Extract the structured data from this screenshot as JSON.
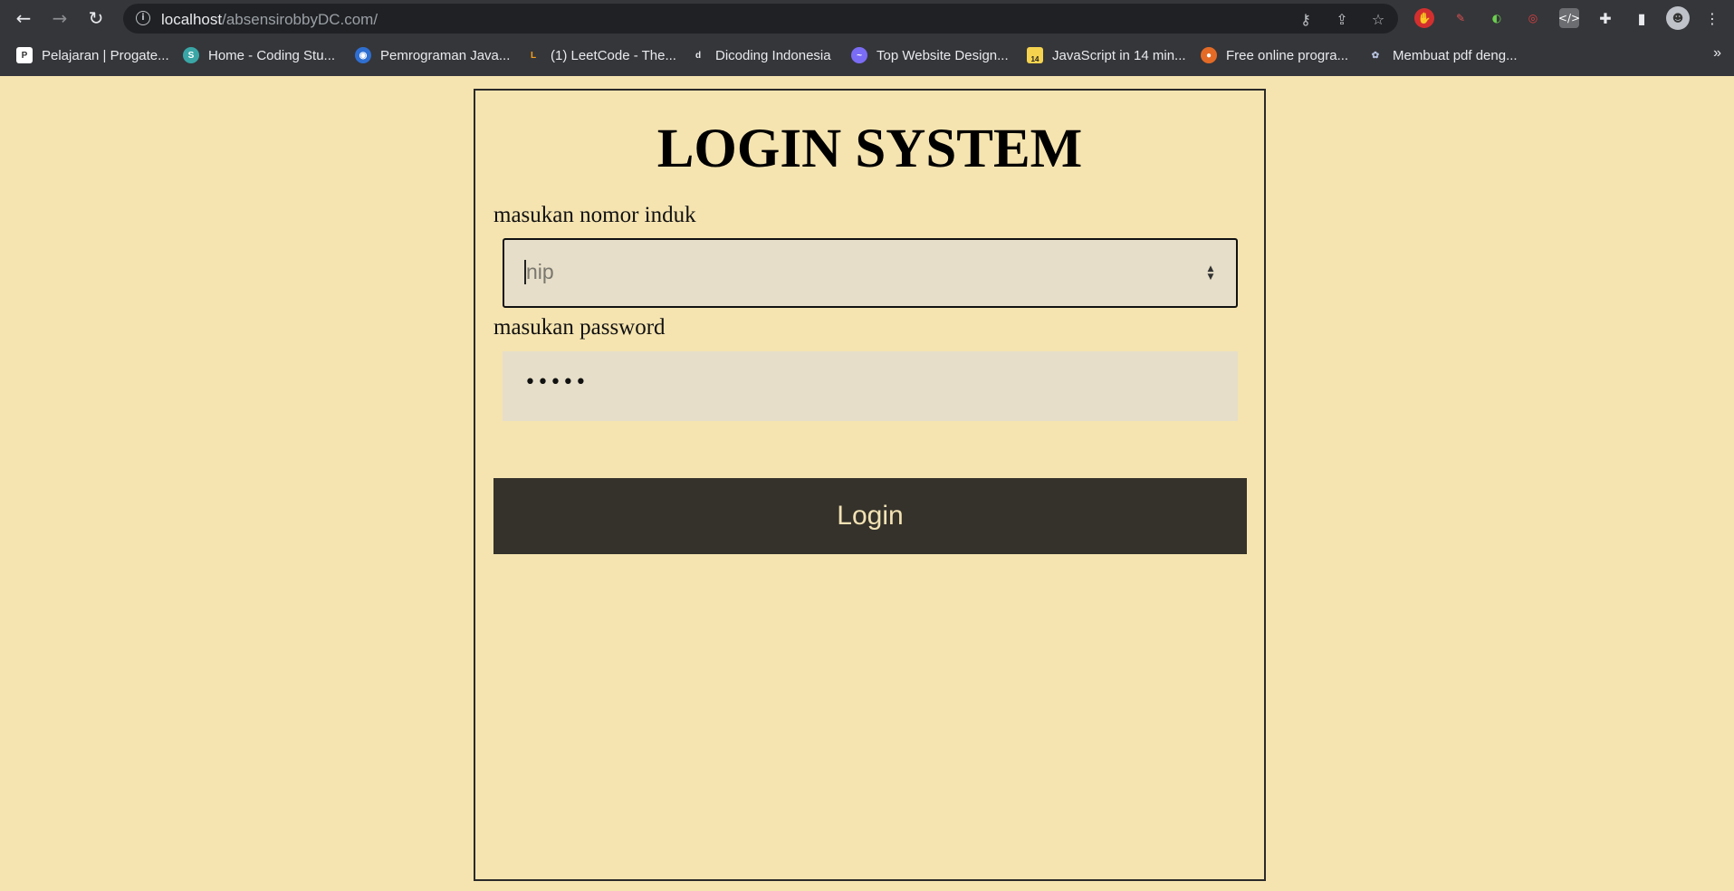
{
  "browser": {
    "url_host": "localhost",
    "url_path": "/absensirobbyDC.com/",
    "bookmarks": [
      {
        "label": "Pelajaran | Progate...",
        "color": "#ffffff",
        "glyph": "P"
      },
      {
        "label": "Home - Coding Stu...",
        "color": "#3aa6a6",
        "glyph": "S"
      },
      {
        "label": "Pemrograman Java...",
        "color": "#2f6fd1",
        "glyph": "◉"
      },
      {
        "label": "(1) LeetCode - The...",
        "color": "#f89f1b",
        "glyph": "L"
      },
      {
        "label": "Dicoding Indonesia",
        "color": "#2b3a55",
        "glyph": "d"
      },
      {
        "label": "Top Website Design...",
        "color": "#7b6cf6",
        "glyph": "~"
      },
      {
        "label": "JavaScript in 14 min...",
        "color": "#f5d34f",
        "glyph": "14"
      },
      {
        "label": "Free online progra...",
        "color": "#e46b25",
        "glyph": "●"
      },
      {
        "label": "Membuat pdf deng...",
        "color": "#5a6a8a",
        "glyph": "✿"
      }
    ],
    "more_label": "»"
  },
  "page": {
    "title": "LOGIN SYSTEM",
    "nip_label": "masukan nomor induk",
    "nip_placeholder": "nip",
    "password_label": "masukan password",
    "password_value": "•••••",
    "login_button": "Login"
  },
  "colors": {
    "page_bg": "#f5e4b0",
    "input_bg": "#e6dec8",
    "button_bg": "#35322b",
    "button_text": "#f2e2b4"
  }
}
